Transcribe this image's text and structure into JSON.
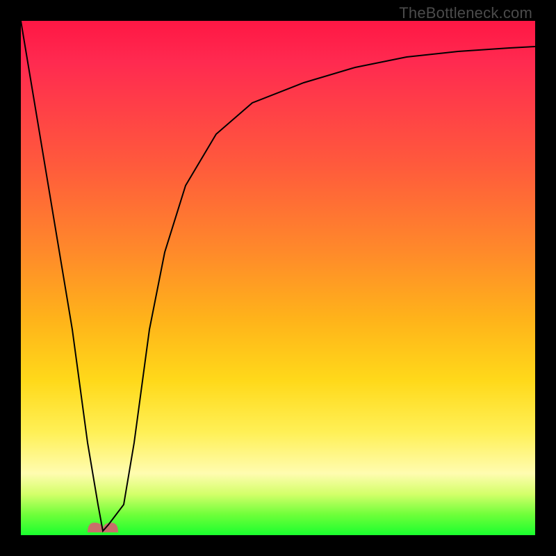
{
  "watermark": "TheBottleneck.com",
  "colors": {
    "gradient_top": "#ff1744",
    "gradient_mid1": "#ff8a2a",
    "gradient_mid2": "#ffd91a",
    "gradient_mid3": "#fffcb0",
    "gradient_bottom": "#1aff2e",
    "curve": "#000000",
    "bump": "#c86f6a",
    "frame": "#000000"
  },
  "chart_data": {
    "type": "line",
    "title": "",
    "xlabel": "",
    "ylabel": "",
    "xlim": [
      0,
      100
    ],
    "ylim": [
      0,
      100
    ],
    "series": [
      {
        "name": "bottleneck-curve",
        "x": [
          0,
          5,
          10,
          13,
          15,
          17,
          20,
          22,
          25,
          28,
          32,
          38,
          45,
          55,
          65,
          75,
          85,
          95,
          100
        ],
        "values": [
          100,
          70,
          40,
          18,
          6,
          2,
          6,
          18,
          38,
          55,
          68,
          78,
          84,
          88,
          91,
          93,
          94,
          94.8,
          95
        ]
      }
    ],
    "annotations": [
      {
        "name": "valley-bump",
        "x_center": 16,
        "y": 0.5,
        "width": 6
      }
    ],
    "grid": false,
    "legend": false
  }
}
